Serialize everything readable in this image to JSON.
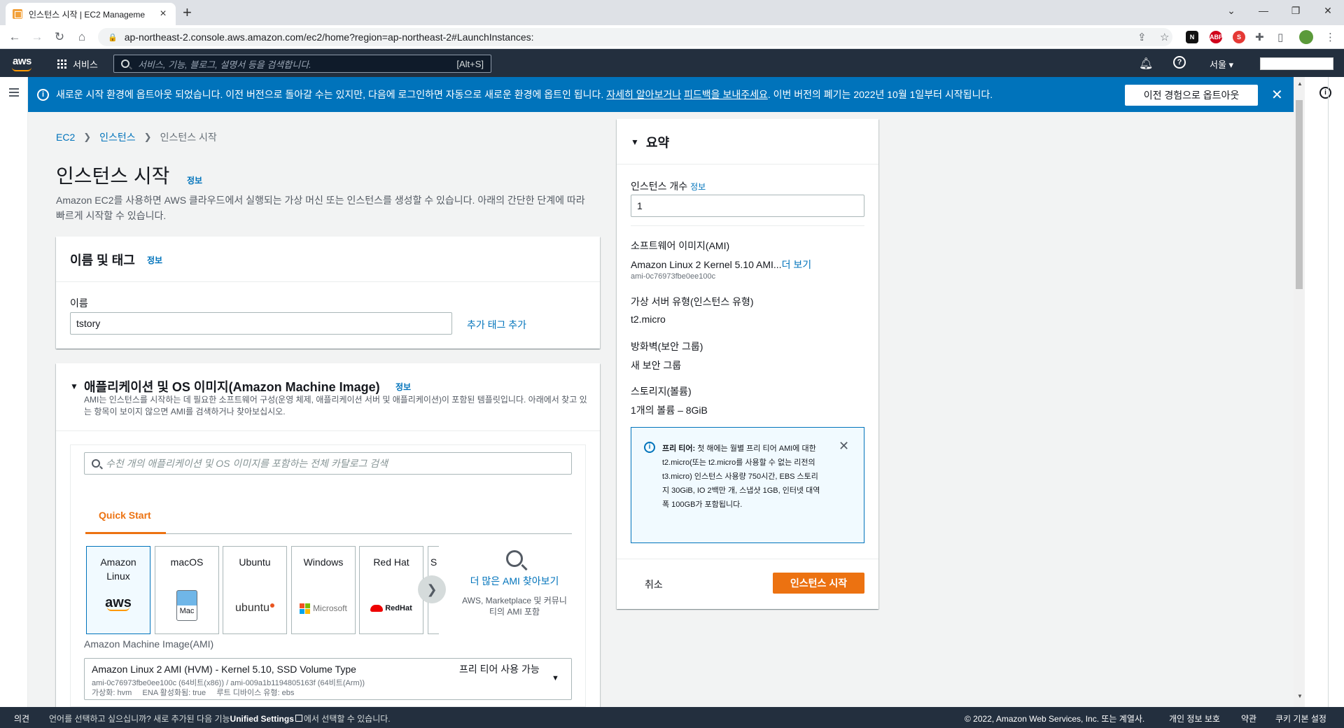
{
  "browser": {
    "tab_title": "인스턴스 시작 | EC2 Manageme",
    "url": "ap-northeast-2.console.aws.amazon.com/ec2/home?region=ap-northeast-2#LaunchInstances:"
  },
  "aws_nav": {
    "logo": "aws",
    "services": "서비스",
    "search_placeholder": "서비스, 기능, 블로그, 설명서 등을 검색합니다.",
    "search_shortcut": "[Alt+S]",
    "region": "서울 ▾"
  },
  "flash": {
    "text_before": "새로운 시작 환경에 옵트아웃 되었습니다. 이전 버전으로 돌아갈 수는 있지만, 다음에 로그인하면 자동으로 새로운 환경에 옵트인 됩니다. ",
    "link1": "자세히 알아보거나",
    "link2": "피드백을 보내주세요",
    "text_after": ". 이번 버전의 폐기는 2022년 10월 1일부터 시작됩니다.",
    "button": "이전 경험으로 옵트아웃"
  },
  "breadcrumb": [
    "EC2",
    "인스턴스",
    "인스턴스 시작"
  ],
  "page": {
    "title": "인스턴스 시작",
    "info": "정보",
    "description": "Amazon EC2를 사용하면 AWS 클라우드에서 실행되는 가상 머신 또는 인스턴스를 생성할 수 있습니다. 아래의 간단한 단계에 따라 빠르게 시작할 수 있습니다."
  },
  "name_tags": {
    "title": "이름 및 태그",
    "info": "정보",
    "name_label": "이름",
    "name_value": "tstory",
    "add_tag": "추가 태그 추가"
  },
  "ami": {
    "title": "애플리케이션 및 OS 이미지(Amazon Machine Image)",
    "info": "정보",
    "description": "AMI는 인스턴스를 시작하는 데 필요한 소프트웨어 구성(운영 체제, 애플리케이션 서버 및 애플리케이션)이 포함된 템플릿입니다. 아래에서 찾고 있는 항목이 보이지 않으면 AMI를 검색하거나 찾아보십시오.",
    "search_placeholder": "수천 개의 애플리케이션 및 OS 이미지를 포함하는 전체 카탈로그 검색",
    "tab": "Quick Start",
    "tiles": [
      "Amazon Linux",
      "macOS",
      "Ubuntu",
      "Windows",
      "Red Hat",
      "S"
    ],
    "logos": {
      "aws": "aws",
      "mac": "Mac",
      "ubuntu": "ubuntu",
      "microsoft": "Microsoft",
      "redhat": "RedHat"
    },
    "more_link": "더 많은 AMI 찾아보기",
    "more_sub": "AWS, Marketplace 및 커뮤니티의 AMI 포함",
    "select_label": "Amazon Machine Image(AMI)",
    "select_title": "Amazon Linux 2 AMI (HVM) - Kernel 5.10, SSD Volume Type",
    "select_ids": "ami-0c76973fbe0ee100c (64비트(x86)) / ami-009a1b1194805163f (64비트(Arm))",
    "select_meta": "가상화: hvm     ENA 활성화됨: true     루트 디바이스 유형: ebs",
    "free_tier": "프리 티어 사용 가능"
  },
  "summary": {
    "title": "요약",
    "count_label": "인스턴스 개수",
    "count_info": "정보",
    "count_value": "1",
    "ami_label": "소프트웨어 이미지(AMI)",
    "ami_value": "Amazon Linux 2 Kernel 5.10 AMI...",
    "ami_more": "더 보기",
    "ami_id": "ami-0c76973fbe0ee100c",
    "type_label": "가상 서버 유형(인스턴스 유형)",
    "type_value": "t2.micro",
    "fw_label": "방화벽(보안 그룹)",
    "fw_value": "새 보안 그룹",
    "storage_label": "스토리지(볼륨)",
    "storage_value": "1개의 볼륨 – 8GiB",
    "free_tier_bold": "프리 티어:",
    "free_tier_text": " 첫 해에는 월별 프리 티어 AMI에 대한 t2.micro(또는 t2.micro를 사용할 수 없는 리전의 t3.micro) 인스턴스 사용량 750시간, EBS 스토리지 30GiB, IO 2백만 개, 스냅샷 1GB, 인터넷 대역폭 100GB가 포함됩니다.",
    "cancel": "취소",
    "launch": "인스턴스 시작"
  },
  "footer": {
    "feedback": "의견",
    "lang_text": "언어를 선택하고 싶으십니까? 새로 추가된 다음 기능",
    "lang_bold": "Unified Settings",
    "lang_after": "에서 선택할 수 있습니다.",
    "copyright": "© 2022, Amazon Web Services, Inc. 또는 계열사.",
    "privacy": "개인 정보 보호",
    "terms": "약관",
    "cookie": "쿠키 기본 설정"
  }
}
